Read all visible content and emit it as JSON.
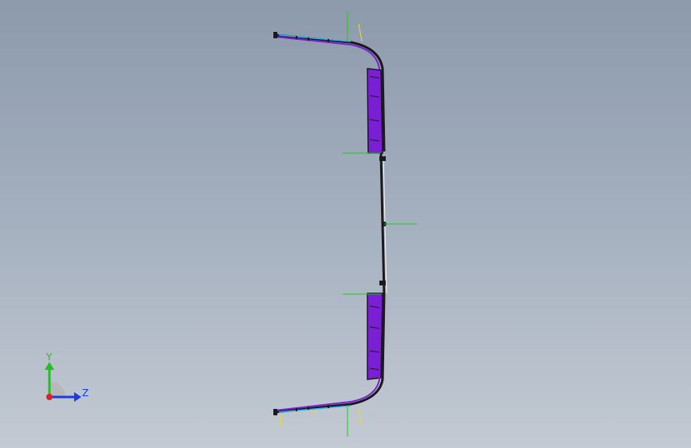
{
  "viewport": {
    "background_top": "#8d9aac",
    "background_bottom": "#c3cad3"
  },
  "model": {
    "part_color": "#7a1fd6",
    "edge_color": "#1a1a1a",
    "highlight_color": "#39b4e8",
    "reference_line_color": "#18d018",
    "sketch_line_color": "#e8e020"
  },
  "triad": {
    "y_label": "Y",
    "z_label": "Z",
    "y_color": "#20c020",
    "z_color": "#1a3ce0",
    "x_color": "#e02020"
  }
}
